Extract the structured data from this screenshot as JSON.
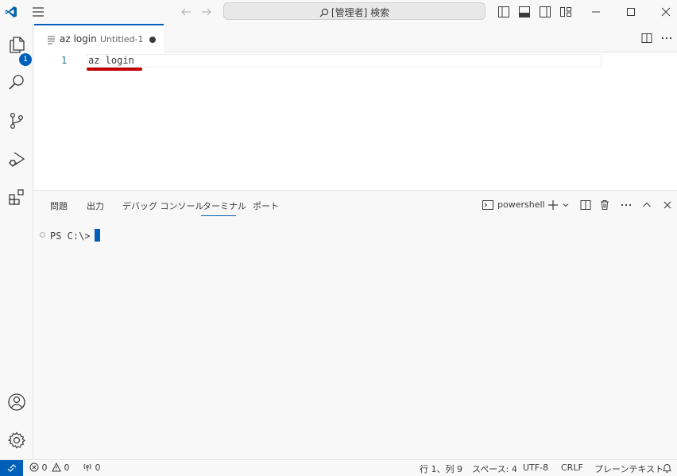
{
  "titlebar": {
    "search_text": "[管理者] 検索"
  },
  "activitybar": {
    "explorer_badge": "1"
  },
  "editor": {
    "tab_name": "az login",
    "tab_description": "Untitled-1",
    "line_number": "1",
    "code": "az login"
  },
  "panel": {
    "tabs": [
      "問題",
      "出力",
      "デバッグ コンソール",
      "ターミナル",
      "ポート"
    ],
    "active_tab": "ターミナル",
    "terminal_label": "powershell",
    "prompt": "PS C:\\>"
  },
  "statusbar": {
    "errors": "0",
    "warnings": "0",
    "ports": "0",
    "position": "行 1、列 9",
    "spaces": "スペース: 4",
    "encoding": "UTF-8",
    "eol": "CRLF",
    "language": "プレーンテキスト"
  },
  "colors": {
    "accent": "#005fb8",
    "error_squiggle": "#c00000",
    "line_number": "#237893"
  }
}
